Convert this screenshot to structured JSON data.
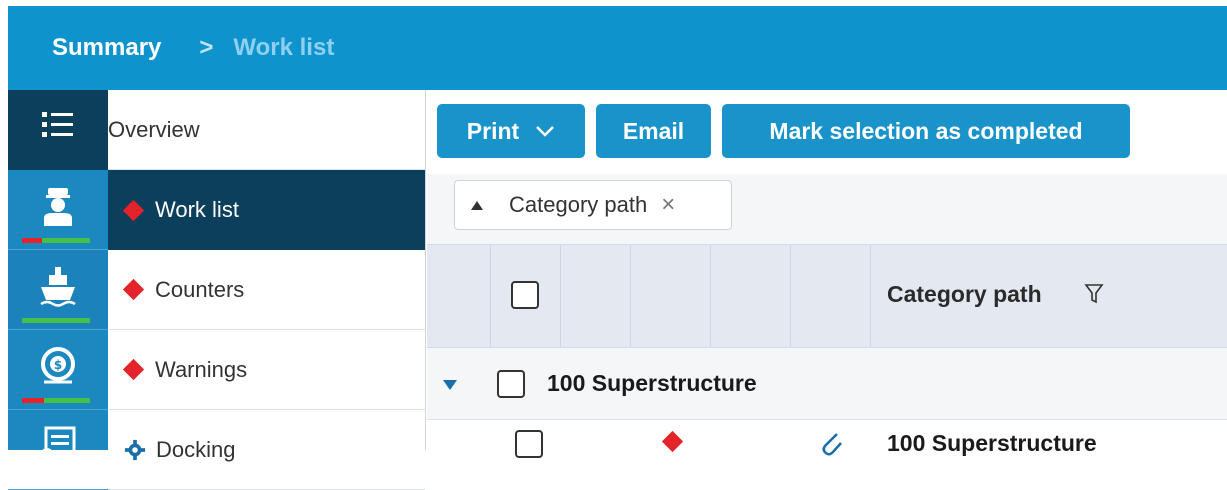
{
  "breadcrumb": {
    "home": "Summary",
    "separator": ">",
    "current": "Work list"
  },
  "rail": {
    "items": [
      {
        "icon": "list-menu-icon"
      },
      {
        "icon": "captain-icon",
        "status": "red-green"
      },
      {
        "icon": "ship-icon",
        "status": "green"
      },
      {
        "icon": "dollar-cycle-icon",
        "status": "red-green"
      },
      {
        "icon": "document-list-icon"
      }
    ]
  },
  "subnav": {
    "items": [
      {
        "label": "Overview",
        "marker": "none"
      },
      {
        "label": "Work list",
        "marker": "diamond",
        "active": true
      },
      {
        "label": "Counters",
        "marker": "diamond"
      },
      {
        "label": "Warnings",
        "marker": "diamond"
      },
      {
        "label": "Docking",
        "marker": "gear"
      }
    ]
  },
  "toolbar": {
    "print_label": "Print",
    "email_label": "Email",
    "mark_label": "Mark selection as completed"
  },
  "grouping": {
    "chip_label": "Category path",
    "chip_remove": "×"
  },
  "grid": {
    "column_title": "Category path",
    "group_title": "100 Superstructure",
    "first_row_text": "100 Superstructure"
  },
  "colors": {
    "header": "#0f93cd",
    "rail": "#1b88c0",
    "dark_active": "#0c3f5b",
    "button": "#1a93cb",
    "marker_red": "#e5232a",
    "status_green": "#46c046"
  }
}
